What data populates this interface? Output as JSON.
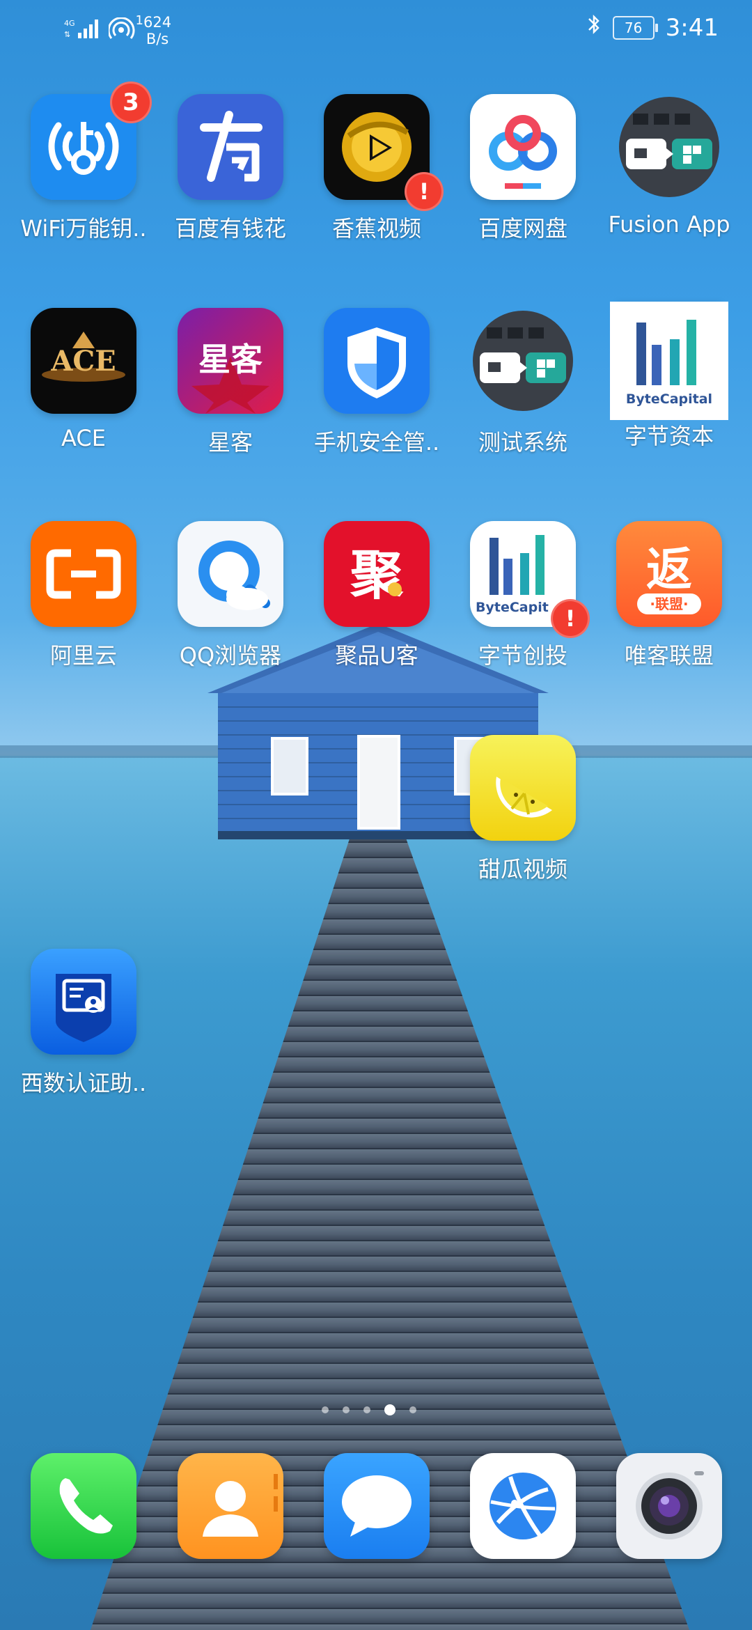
{
  "status_bar": {
    "network": "4G",
    "hotspot_count": "1",
    "speed_value": "624",
    "speed_unit": "B/s",
    "battery": "76",
    "time": "3:41",
    "icons": [
      "signal-icon",
      "hotspot-icon",
      "bluetooth-icon",
      "battery-icon"
    ]
  },
  "apps": [
    {
      "label": "WiFi万能钥..",
      "badge": "3"
    },
    {
      "label": "百度有钱花"
    },
    {
      "label": "香蕉视频",
      "badge": "!"
    },
    {
      "label": "百度网盘"
    },
    {
      "label": "Fusion App"
    },
    {
      "label": "ACE",
      "icon_text": "ACE"
    },
    {
      "label": "星客",
      "icon_text": "星客"
    },
    {
      "label": "手机安全管.."
    },
    {
      "label": "测试系统"
    },
    {
      "label": "字节资本",
      "icon_text": "ByteCapital"
    },
    {
      "label": "阿里云"
    },
    {
      "label": "QQ浏览器"
    },
    {
      "label": "聚品U客",
      "icon_text": "聚"
    },
    {
      "label": "字节创投",
      "icon_text": "ByteCapit",
      "badge": "!"
    },
    {
      "label": "唯客联盟",
      "icon_text": "·联盟·"
    },
    {
      "label": "甜瓜视频"
    },
    {
      "label": "西数认证助.."
    }
  ],
  "page_indicator": {
    "pages": 5,
    "current": 4
  },
  "dock": [
    {
      "name": "phone-icon"
    },
    {
      "name": "contacts-icon"
    },
    {
      "name": "messages-icon"
    },
    {
      "name": "browser-icon"
    },
    {
      "name": "camera-icon"
    }
  ],
  "colors": {
    "badge": "#f23c30",
    "sky": "#3d9ee6",
    "sea": "#2f88c2"
  }
}
